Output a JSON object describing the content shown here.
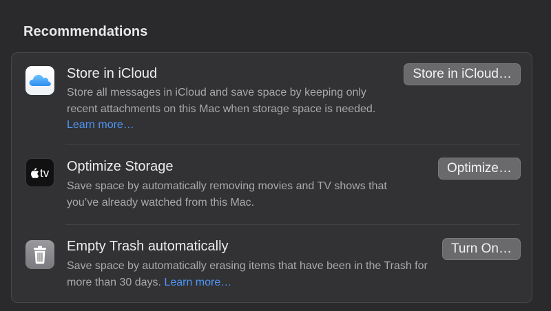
{
  "section": {
    "title": "Recommendations"
  },
  "recommendations": [
    {
      "title": "Store in iCloud",
      "description": "Store all messages in iCloud and save space by keeping only recent attachments on this Mac when storage space is needed.",
      "link": "Learn more…",
      "button": "Store in iCloud…",
      "icon": "icloud-icon"
    },
    {
      "title": "Optimize Storage",
      "description": "Save space by automatically removing movies and TV shows that you’ve already watched from this Mac.",
      "button": "Optimize…",
      "icon": "apple-tv-icon",
      "icon_text": "tv"
    },
    {
      "title": "Empty Trash automatically",
      "description": "Save space by automatically erasing items that have been in the Trash for more than 30 days.",
      "link": "Learn more…",
      "button": "Turn On…",
      "icon": "trash-icon"
    }
  ],
  "colors": {
    "background": "#2a2a2c",
    "panel": "#323234",
    "link": "#4f96f7",
    "button": "#6a6a6d"
  }
}
